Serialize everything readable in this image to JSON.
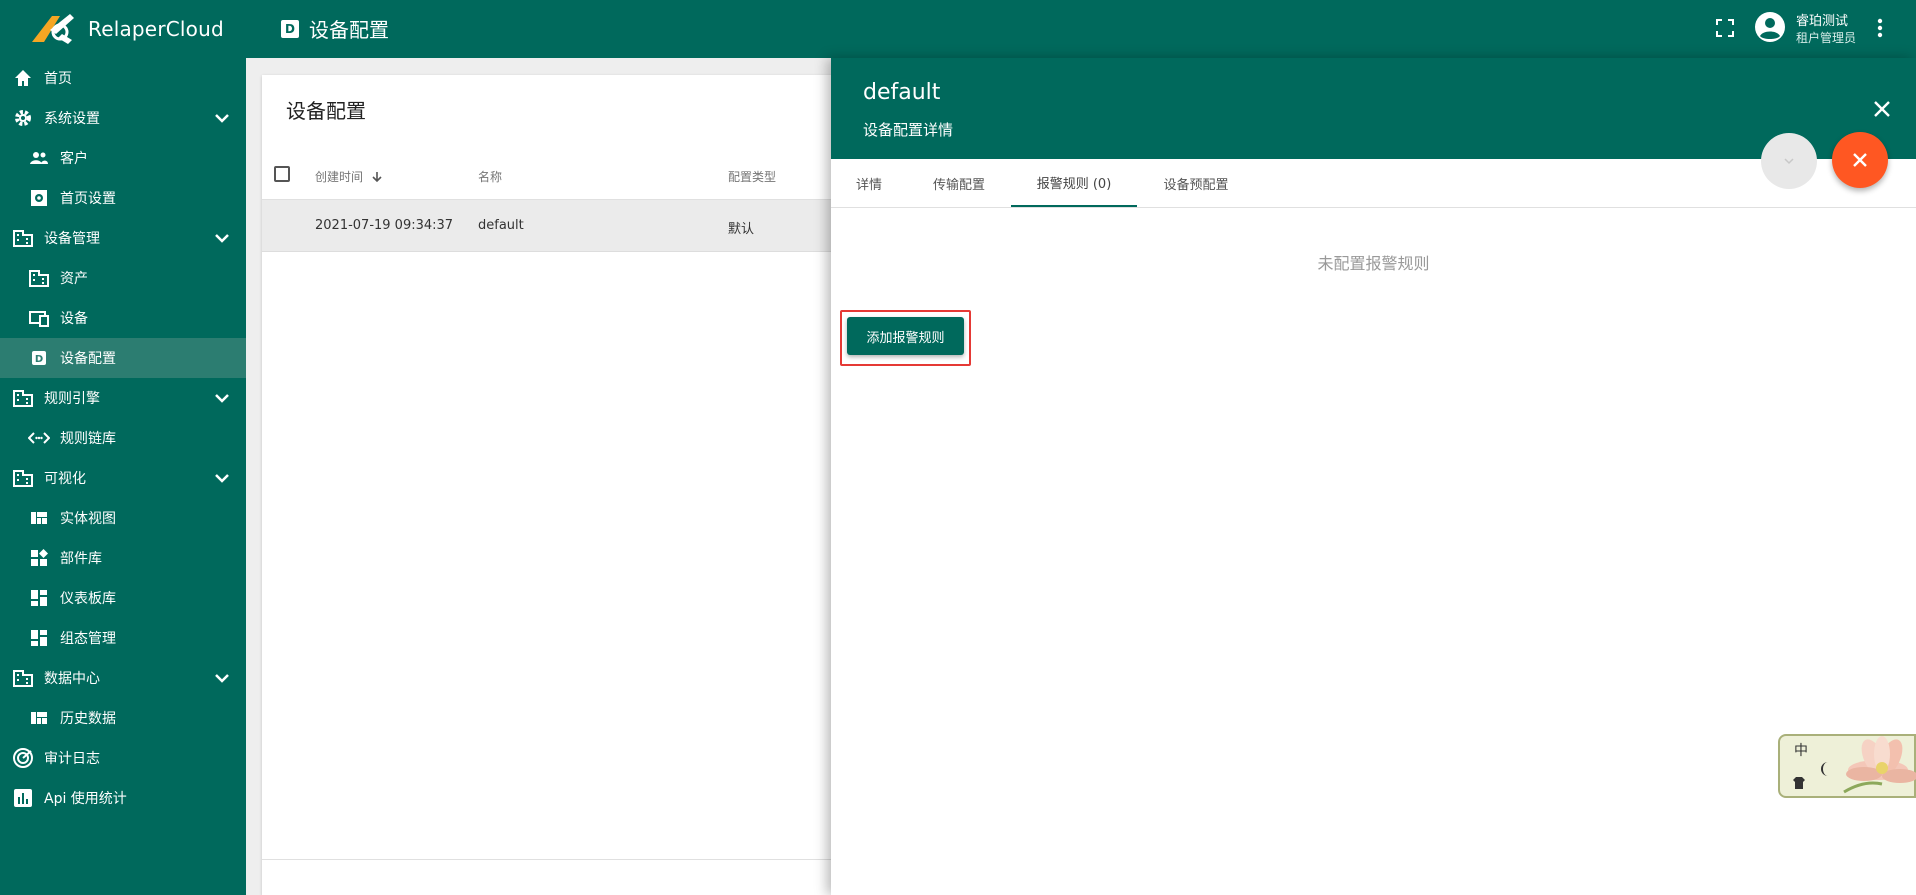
{
  "app": {
    "brand": "RelaperCloud"
  },
  "header": {
    "page_badge": "D",
    "page_title": "设备配置",
    "user": {
      "name": "睿珀测试",
      "role": "租户管理员"
    }
  },
  "sidebar": {
    "items": [
      {
        "label": "首页",
        "icon": "home-icon"
      },
      {
        "label": "系统设置",
        "icon": "gear-icon",
        "expandable": true
      },
      {
        "label": "客户",
        "icon": "people-icon"
      },
      {
        "label": "首页设置",
        "icon": "settings-box-icon"
      },
      {
        "label": "设备管理",
        "icon": "building-icon",
        "expandable": true
      },
      {
        "label": "资产",
        "icon": "building-icon"
      },
      {
        "label": "设备",
        "icon": "devices-icon"
      },
      {
        "label": "设备配置",
        "icon": "device-profile-icon",
        "active": true
      },
      {
        "label": "规则引擎",
        "icon": "building-icon",
        "expandable": true
      },
      {
        "label": "规则链库",
        "icon": "code-icon"
      },
      {
        "label": "可视化",
        "icon": "building-icon",
        "expandable": true
      },
      {
        "label": "实体视图",
        "icon": "view-quilt-icon"
      },
      {
        "label": "部件库",
        "icon": "widgets-icon"
      },
      {
        "label": "仪表板库",
        "icon": "dashboard-icon"
      },
      {
        "label": "组态管理",
        "icon": "dashboard-icon"
      },
      {
        "label": "数据中心",
        "icon": "building-icon",
        "expandable": true
      },
      {
        "label": "历史数据",
        "icon": "view-quilt-icon"
      },
      {
        "label": "审计日志",
        "icon": "track-changes-icon"
      },
      {
        "label": "Api 使用统计",
        "icon": "chart-icon"
      }
    ]
  },
  "main": {
    "title": "设备配置",
    "columns": [
      "创建时间",
      "名称",
      "配置类型"
    ],
    "rows": [
      {
        "created": "2021-07-19 09:34:37",
        "name": "default",
        "type": "默认"
      }
    ]
  },
  "drawer": {
    "title": "default",
    "subtitle": "设备配置详情",
    "tabs": [
      "详情",
      "传输配置",
      "报警规则 (0)",
      "设备预配置"
    ],
    "active_tab": "报警规则 (0)",
    "empty_message": "未配置报警规则",
    "add_button": "添加报警规则"
  },
  "ime": {
    "char": "中"
  },
  "colors": {
    "primary": "#00695c",
    "accent": "#ff5722",
    "highlight": "#e53935"
  }
}
